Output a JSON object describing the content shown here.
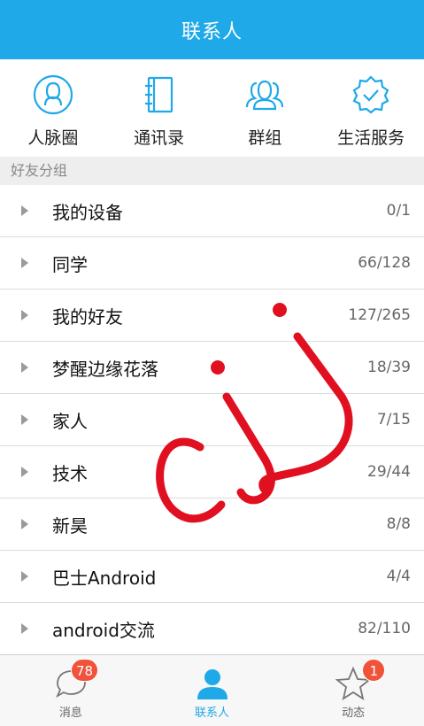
{
  "header": {
    "title": "联系人"
  },
  "shortcuts": [
    {
      "label": "人脉圈",
      "icon": "person-circle-icon"
    },
    {
      "label": "通讯录",
      "icon": "address-book-icon"
    },
    {
      "label": "群组",
      "icon": "group-icon"
    },
    {
      "label": "生活服务",
      "icon": "verified-badge-icon"
    }
  ],
  "groups_section": {
    "title": "好友分组"
  },
  "groups": [
    {
      "name": "我的设备",
      "count": "0/1"
    },
    {
      "name": "同学",
      "count": "66/128"
    },
    {
      "name": "我的好友",
      "count": "127/265"
    },
    {
      "name": "梦醒边缘花落",
      "count": "18/39"
    },
    {
      "name": "家人",
      "count": "7/15"
    },
    {
      "name": "技术",
      "count": "29/44"
    },
    {
      "name": "新昊",
      "count": "8/8"
    },
    {
      "name": "巴士Android",
      "count": "4/4"
    },
    {
      "name": "android交流",
      "count": "82/110"
    }
  ],
  "watermark": {
    "text": "cjj",
    "color": "#e01020"
  },
  "tabbar": {
    "messages": {
      "label": "消息",
      "badge": "78"
    },
    "contacts": {
      "label": "联系人"
    },
    "moments": {
      "label": "动态",
      "badge": "1"
    }
  },
  "colors": {
    "accent": "#1fa9e8",
    "badge": "#f0523a"
  }
}
